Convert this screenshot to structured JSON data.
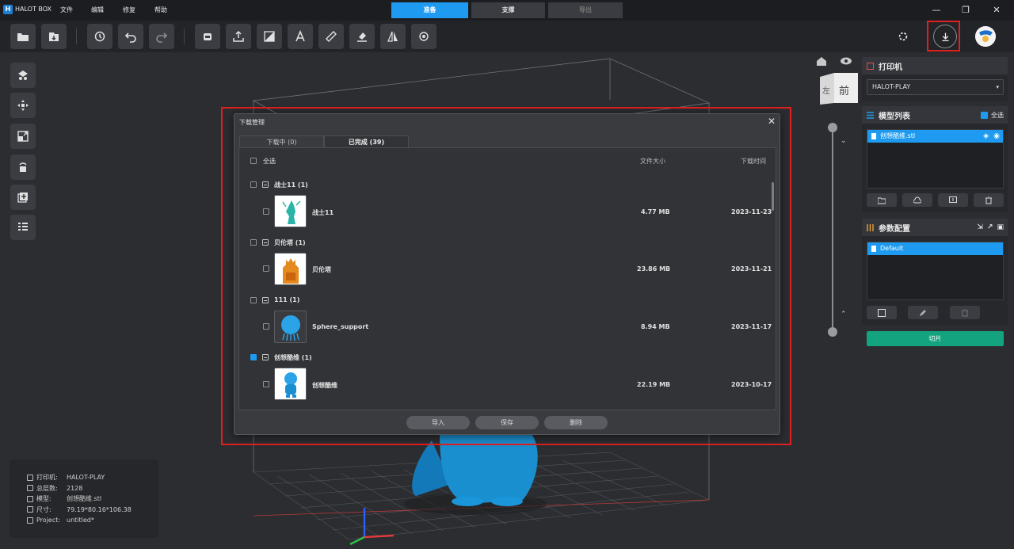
{
  "app": {
    "title": "HALOT BOX"
  },
  "menu": [
    "文件",
    "编辑",
    "修复",
    "帮助"
  ],
  "mode_tabs": [
    {
      "label": "准备",
      "active": true
    },
    {
      "label": "支撑",
      "active": false
    },
    {
      "label": "导出",
      "active": false
    }
  ],
  "toolbar_icons": [
    "folder-open-icon",
    "import-icon",
    "history-icon",
    "undo-icon",
    "redo-icon",
    "cloud-print-icon",
    "upload-icon",
    "hollow-icon",
    "text-icon",
    "measure-icon",
    "lay-flat-icon",
    "mirror-icon",
    "support-gen-icon"
  ],
  "side_tools": [
    "arrange-icon",
    "move-icon",
    "scale-icon",
    "rotate-icon",
    "add-model-icon",
    "list-view-icon"
  ],
  "view_cube": {
    "front": "前",
    "left": "左"
  },
  "info": {
    "rows": [
      {
        "label": "打印机:",
        "value": "HALOT-PLAY"
      },
      {
        "label": "总层数:",
        "value": "2128"
      },
      {
        "label": "模型:",
        "value": "创想酷维.stl"
      },
      {
        "label": "尺寸:",
        "value": "79.19*80.16*106.38"
      },
      {
        "label": "Project:",
        "value": "untitled*"
      }
    ]
  },
  "printer_panel": {
    "title": "打印机",
    "selected": "HALOT-PLAY"
  },
  "model_panel": {
    "title": "模型列表",
    "select_all": "全选",
    "selected_item": "创想酷维.stl"
  },
  "param_panel": {
    "title": "参数配置",
    "selected_item": "Default"
  },
  "slice_button": "切片",
  "dialog": {
    "title": "下载管理",
    "tabs": [
      {
        "label": "下载中 (0)",
        "active": false
      },
      {
        "label": "已完成 (39)",
        "active": true
      }
    ],
    "header": {
      "select_all": "全选",
      "size": "文件大小",
      "time": "下载时间"
    },
    "groups": [
      {
        "name": "战士11 (1)",
        "checked": false,
        "item": {
          "name": "战士11",
          "size": "4.77 MB",
          "date": "2023-11-23",
          "thumb": "teal-figure"
        }
      },
      {
        "name": "贝伦塔 (1)",
        "checked": false,
        "item": {
          "name": "贝伦塔",
          "size": "23.86 MB",
          "date": "2023-11-21",
          "thumb": "orange-tower"
        }
      },
      {
        "name": "111 (1)",
        "checked": false,
        "item": {
          "name": "Sphere_support",
          "size": "8.94 MB",
          "date": "2023-11-17",
          "thumb": "blue-sphere"
        }
      },
      {
        "name": "创想酷维 (1)",
        "checked": true,
        "item": {
          "name": "创想酷维",
          "size": "22.19 MB",
          "date": "2023-10-17",
          "thumb": "blue-mascot"
        }
      }
    ],
    "buttons": {
      "import": "导入",
      "save": "保存",
      "delete": "删除"
    }
  },
  "colors": {
    "accent": "#1e9bf0",
    "slice": "#14a37f",
    "highlight": "#e02020",
    "model": "#1a8fd0"
  }
}
